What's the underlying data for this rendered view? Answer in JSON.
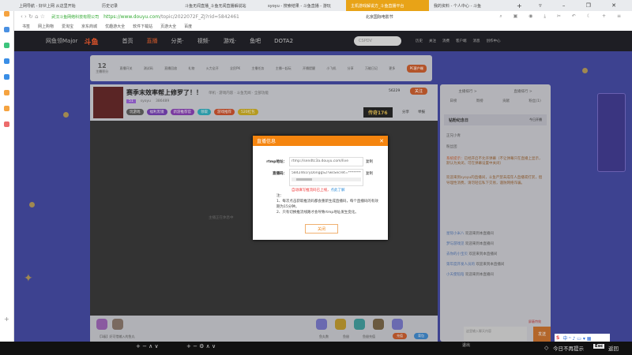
{
  "browser": {
    "tabs": [
      {
        "label": "上网导航 - 好伙上网 从这里开始"
      },
      {
        "label": "历史记录"
      },
      {
        "label": "斗鱼无闻直播_斗鱼无闻直播解说站"
      },
      {
        "label": "syoyu - 搜索结果 - 斗鱼直播 - 游玩"
      },
      {
        "label": "主机游戏解说方_斗鱼直播平台"
      },
      {
        "label": "我的资料 - 个人中心 - 斗鱼"
      }
    ],
    "active_tab": 4,
    "address": {
      "site_name": "武汉斗鱼网络科技有限公司",
      "url_host": "https://www.douyu.com",
      "url_path": "/topic/2022072F_ZJ?rid=5842461"
    },
    "search_hint": "北京国际电影节",
    "bookmarks": [
      "书签",
      "网上购物",
      "爱淘宝",
      "京东商城",
      "优趣游大全",
      "软件下载站",
      "页游大全",
      "百度"
    ]
  },
  "header": {
    "logo": "斗鱼",
    "nav": [
      "首页",
      "直播",
      "分类·",
      "视频·",
      "游戏·",
      "鱼吧",
      "DOTA2"
    ],
    "search_placeholder": "CSPDV",
    "user_links": [
      "历史",
      "关注",
      "消费",
      "客户端",
      "消息",
      "创作中心"
    ],
    "banner": "网鱼领Major"
  },
  "toolbar": {
    "count": "12",
    "count_label": "主播积分",
    "items": [
      "直播开关",
      "测试码",
      "直播回放",
      "礼物",
      "火力全开",
      "全民PK",
      "主播任务",
      "主播一起玩",
      "开播提醒",
      "小飞机",
      "分享",
      "万能日记",
      "更多"
    ],
    "pc_button": "PC客户端"
  },
  "room": {
    "title": "赛季末效率帮上修罗了！！",
    "category": "单机 · 游戏内容 · 斗鱼无闻 · 全部功能",
    "level": "51",
    "streamer": "syoyu",
    "hot": "386489",
    "follow": "关注",
    "tags": [
      "玩游戏",
      "福利黑镜",
      "新游推荐官",
      "领取",
      "游戏推荐",
      "520红包"
    ],
    "fans": "56229",
    "ad": "传奇176",
    "share": "分享",
    "report": "举报"
  },
  "video": {
    "status": "主播正在休息中"
  },
  "gifts": {
    "notice": "【1级】好可惜输入的鱼丸",
    "footer": [
      "鱼丸数",
      "鱼翅",
      "鱼翅充值"
    ],
    "recharge": "充值",
    "gift_btn": "背包"
  },
  "chat": {
    "tabs": [
      "日榜",
      "周榜",
      "贡献",
      "粉丝(1)"
    ],
    "rank_links": [
      "主播排行 >",
      "直播排行 >"
    ],
    "diamond_title": "钻粉纪念日",
    "diamond_status": "今日开播",
    "fans": [
      {
        "name": "正兄小青"
      },
      {
        "name": "粉丝团"
      }
    ],
    "system_title": "系统提示：",
    "system_msg": "已经开启不允许弹幕（不让弹幕只在直播上显示，默认为关闭，可在弹幕设置中关闭）",
    "welcome": "欢迎来到syoyu的直播间，斗鱼严禁未成年人直播或打赏，倡导理性消费，请勿轻信私下交易，谨防网络诈骗。",
    "messages": [
      {
        "user": "星际小米八",
        "text": "欢迎来到本直播间"
      },
      {
        "user": "梦与游戏见",
        "text": "欢迎来到本直播间"
      },
      {
        "user": "去你的小宝贝",
        "text": "欢迎来到本直播间"
      },
      {
        "user": "第年度开发人员的",
        "text": "欢迎来到本直播间"
      },
      {
        "user": "小天使陪陪",
        "text": "欢迎来到本直播间"
      }
    ],
    "input_placeholder": "这里输入聊天内容",
    "send": "发送",
    "danmu": "屏蔽特效"
  },
  "modal": {
    "title": "直播信息",
    "rtmp_label": "rtmp地址：",
    "rtmp_value": "rtmp://sendtc3a.douyu.com/live",
    "code_label": "直播码：",
    "code_value": "5842461ryDonggS2?wsSecret=**********",
    "copy": "复制",
    "warning": "自动填写推流码已上线，",
    "learn_more": "点此了解",
    "note_title": "注：",
    "notes": [
      "1、每次点击获取推流码都会重新生成直播码，每个直播码的有效期为15分钟。",
      "2、只有切换推流线路才会导致rtmp地址发生变化。"
    ],
    "close": "关闭"
  },
  "overlay": {
    "hint": "今日不再提示",
    "esc": "Esc",
    "back": "返回",
    "control": "+ − ∧ ∨",
    "control2": "+ − ⚙ ∧ ∨",
    "panel": "退出"
  }
}
